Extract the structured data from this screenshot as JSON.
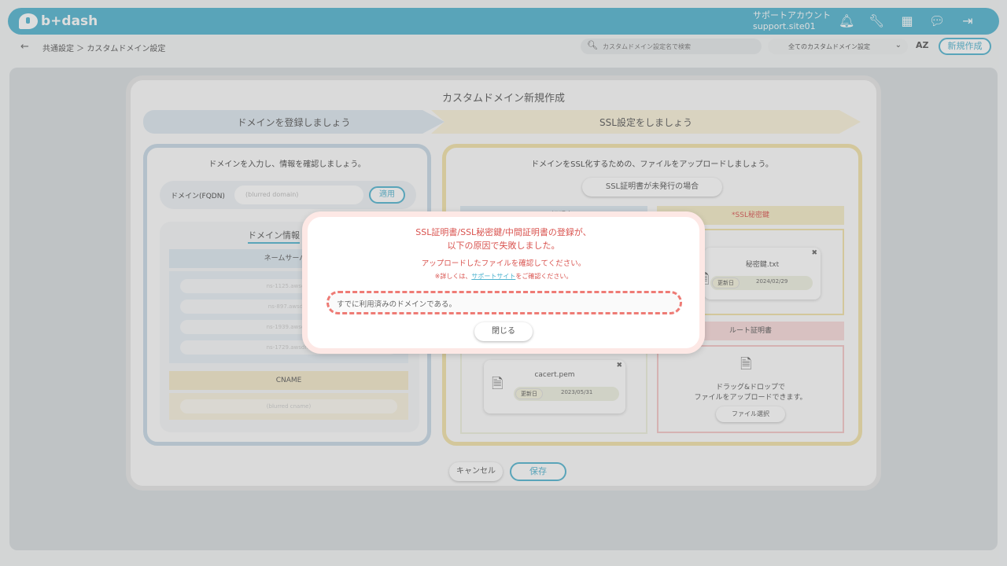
{
  "app": {
    "logo_text": "b+dash"
  },
  "header": {
    "account_line1": "サポートアカウント",
    "account_line2": "support.site01"
  },
  "toolbar": {
    "breadcrumb": "共通設定 ＞ カスタムドメイン設定",
    "search_placeholder": "カスタムドメイン設定名で検索",
    "filter_selected": "全てのカスタムドメイン設定",
    "sort_label": "AZ",
    "new_button": "新規作成"
  },
  "modal": {
    "title": "カスタムドメイン新規作成",
    "step1": "ドメインを登録しましょう",
    "step2": "SSL設定をしましょう",
    "left": {
      "heading": "ドメインを入力し、情報を確認しましょう。",
      "fqdn_label": "ドメイン(FQDN)",
      "fqdn_value": "(blurred domain)",
      "apply_button": "適用",
      "info_title": "ドメイン情報",
      "ns_header": "ネームサーバー",
      "ns_items": [
        "ns-1125.awsdns",
        "ns-897.awsdns",
        "ns-1939.awsdns",
        "ns-1729.awsdns"
      ],
      "cname_header": "CNAME",
      "cname_value": "(blurred cname)"
    },
    "right": {
      "heading": "ドメインをSSL化するための、ファイルをアップロードしましょう。",
      "unissued_button": "SSL証明書が未発行の場合",
      "ssl_cert_header": "*SSL証明書",
      "ssl_key_header": "*SSL秘密鍵",
      "key_file": {
        "name": "秘密鍵.txt",
        "date_label": "更新日",
        "date": "2024/02/29"
      },
      "intermediate_file": {
        "name": "cacert.pem",
        "date_label": "更新日",
        "date": "2023/05/31"
      },
      "root_header": "ルート証明書",
      "drop_line1": "ドラッグ&ドロップで",
      "drop_line2": "ファイルをアップロードできます。",
      "file_select_button": "ファイル選択"
    },
    "cancel_button": "キャンセル",
    "save_button": "保存"
  },
  "error_dialog": {
    "title_line1": "SSL証明書/SSL秘密鍵/中間証明書の登録が、",
    "title_line2": "以下の原因で失敗しました。",
    "subtitle": "アップロードしたファイルを確認してください。",
    "note_prefix": "※詳しくは、",
    "note_link": "サポートサイト",
    "note_suffix": "をご確認ください。",
    "reason": "すでに利用済みのドメインである。",
    "close_button": "閉じる"
  },
  "colors": {
    "accent": "#4fb3cf",
    "error": "#d9534f",
    "error_border": "#ee7b75"
  }
}
